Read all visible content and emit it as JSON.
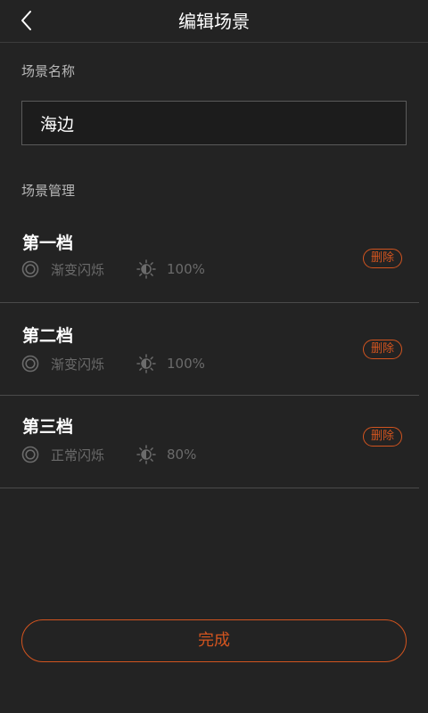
{
  "header": {
    "title": "编辑场景",
    "back_icon": "chevron-left-icon"
  },
  "scene_name": {
    "label": "场景名称",
    "value": "海边"
  },
  "manage": {
    "label": "场景管理"
  },
  "levels": [
    {
      "title": "第一档",
      "mode": "渐变闪烁",
      "brightness": "100%",
      "delete_label": "删除"
    },
    {
      "title": "第二档",
      "mode": "渐变闪烁",
      "brightness": "100%",
      "delete_label": "删除"
    },
    {
      "title": "第三档",
      "mode": "正常闪烁",
      "brightness": "80%",
      "delete_label": "删除"
    }
  ],
  "icons": {
    "mode": "flash-mode-icon",
    "brightness": "brightness-icon"
  },
  "done_label": "完成",
  "colors": {
    "background": "#232323",
    "accent": "#d2541f",
    "muted_text": "#6b6b6b"
  }
}
